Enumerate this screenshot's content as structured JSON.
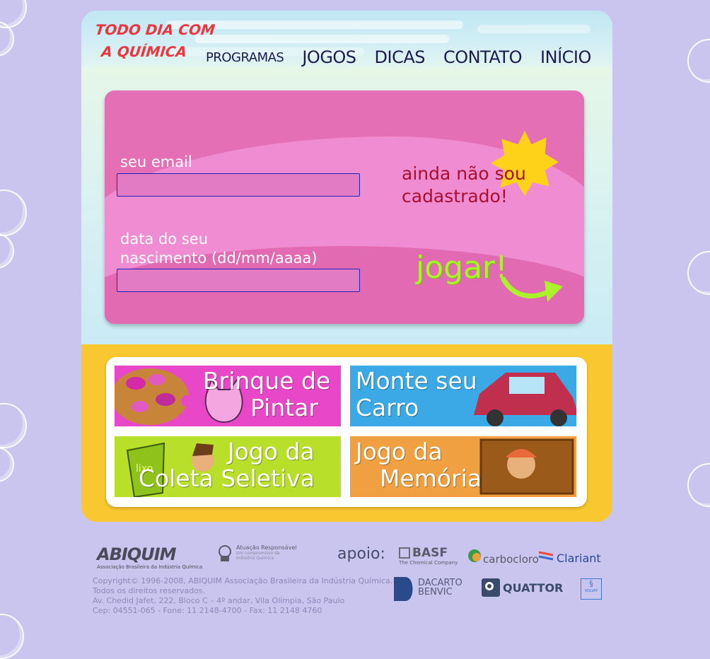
{
  "header": {
    "logo_line1": "TODO DIA COM",
    "logo_line2": "A QUÍMICA",
    "nav": [
      {
        "label": "PROGRAMAS"
      },
      {
        "label": "JOGOS"
      },
      {
        "label": "DICAS"
      },
      {
        "label": "CONTATO"
      },
      {
        "label": "INÍCIO"
      }
    ]
  },
  "login": {
    "email_label": "seu email",
    "email_value": "",
    "birth_label_line1": "data do seu",
    "birth_label_line2": "nascimento (dd/mm/aaaa)",
    "birth_value": "",
    "signup_line1": "ainda não sou",
    "signup_line2": "cadastrado!",
    "play_label": "jogar!"
  },
  "games": [
    {
      "line1": "Brinque de",
      "line2": "Pintar",
      "color": "#e848c8"
    },
    {
      "line1": "Monte seu",
      "line2": "Carro",
      "color": "#3aa9e6"
    },
    {
      "line1": "Jogo da",
      "line2": "Coleta Seletiva",
      "color": "#b8df2a"
    },
    {
      "line1": "Jogo da",
      "line2": "Memória",
      "color": "#f0a040"
    }
  ],
  "lixo_label": "lixo",
  "footer": {
    "abiquim": "ABIQUIM",
    "abiquim_sub": "Associação Brasileira da Indústria Química",
    "atuacao": "Atuação Responsável",
    "atuacao_sub": "Um compromisso da Indústria Química",
    "apoio": "apoio:",
    "sponsors": {
      "basf": "BASF",
      "basf_sub": "The Chemical Company",
      "carbocloro": "carbocloro",
      "clariant": "Clariant",
      "dacarto": "DACARTO",
      "benvic": "BENVIC",
      "quattor": "QUATTOR",
      "solvay": "SOLVAY"
    },
    "copyright_lines": [
      "Copyright© 1996-2008, ABIQUIM Associação Brasileira da Indústria Química.",
      "Todos os direitos reservados.",
      "Av. Chedid Jafet, 222, Bloco C – 4º andar, Vila Olímpia, São Paulo",
      "Cep: 04551-065 - Fone: 11 2148-4700 - Fax: 11 2148 4760"
    ]
  }
}
